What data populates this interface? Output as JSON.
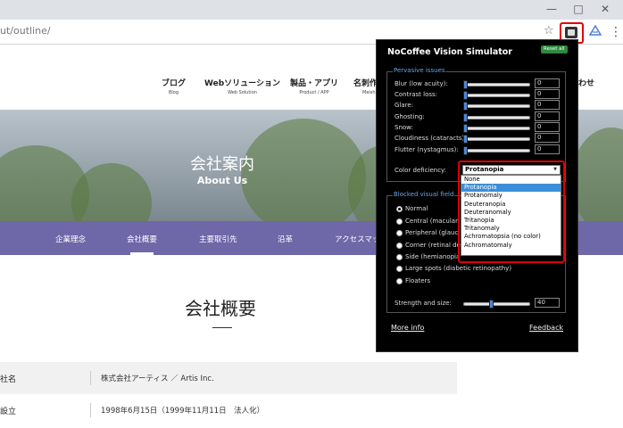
{
  "browser": {
    "url": "ut/outline/",
    "minimize_glyph": "—",
    "maximize_glyph": "□",
    "close_glyph": "✕",
    "star_glyph": "☆",
    "menu_glyph": "⋮"
  },
  "site": {
    "nav": [
      {
        "ja": "ブログ",
        "en": "Blog"
      },
      {
        "ja": "Webソリューション",
        "en": "Web Solution"
      },
      {
        "ja": "製品・アプリ",
        "en": "Product / APP"
      },
      {
        "ja": "名刺作成",
        "en": "Meishi"
      },
      {
        "ja": "わせ",
        "en": ""
      }
    ],
    "hero_title": "会社案内",
    "hero_subtitle": "About Us",
    "subnav": [
      "企業理念",
      "会社概要",
      "主要取引先",
      "沿革",
      "アクセスマップ"
    ],
    "section_title": "会社概要",
    "info_rows": [
      {
        "key": "社名",
        "value": "株式会社アーティス ／ Artis Inc."
      },
      {
        "key": "設立",
        "value": "1998年6月15日（1999年11月11日　法人化）"
      }
    ]
  },
  "popup": {
    "title": "NoCoffee Vision Simulator",
    "reset_label": "Reset all",
    "pervasive_label": "Pervasive issues",
    "sliders": [
      {
        "label": "Blur (low acuity):",
        "value": "0"
      },
      {
        "label": "Contrast loss:",
        "value": "0"
      },
      {
        "label": "Glare:",
        "value": "0"
      },
      {
        "label": "Ghosting:",
        "value": "0"
      },
      {
        "label": "Snow:",
        "value": "0"
      },
      {
        "label": "Cloudiness (cataracts):",
        "value": "0"
      },
      {
        "label": "Flutter (nystagmus):",
        "value": "0"
      }
    ],
    "color_deficiency_label": "Color deficiency:",
    "color_deficiency_selected": "Protanopia",
    "color_deficiency_options": [
      "None",
      "Protanopia",
      "Protanomaly",
      "Deuteranopia",
      "Deuteranomaly",
      "Tritanopia",
      "Tritanomaly",
      "Achromatopsia (no color)",
      "Achromatomaly"
    ],
    "blocked_label": "Blocked visual field",
    "radio_options": [
      {
        "label": "Normal",
        "selected": true
      },
      {
        "label": "Central (macular",
        "selected": false
      },
      {
        "label": "Peripheral (glauc",
        "selected": false
      },
      {
        "label": "Corner (retinal de",
        "selected": false
      },
      {
        "label": "Side (hemianopia",
        "selected": false
      },
      {
        "label": "Large spots (diabetic retinopathy)",
        "selected": false
      },
      {
        "label": "Floaters",
        "selected": false
      }
    ],
    "strength_label": "Strength and size:",
    "strength_value": "40",
    "more_info": "More info",
    "feedback": "Feedback"
  },
  "colors": {
    "subnav_bg": "#6e67a8",
    "highlight_red": "#e00000",
    "selection_blue": "#3b8ed8",
    "reset_green": "#2d8a3e"
  }
}
